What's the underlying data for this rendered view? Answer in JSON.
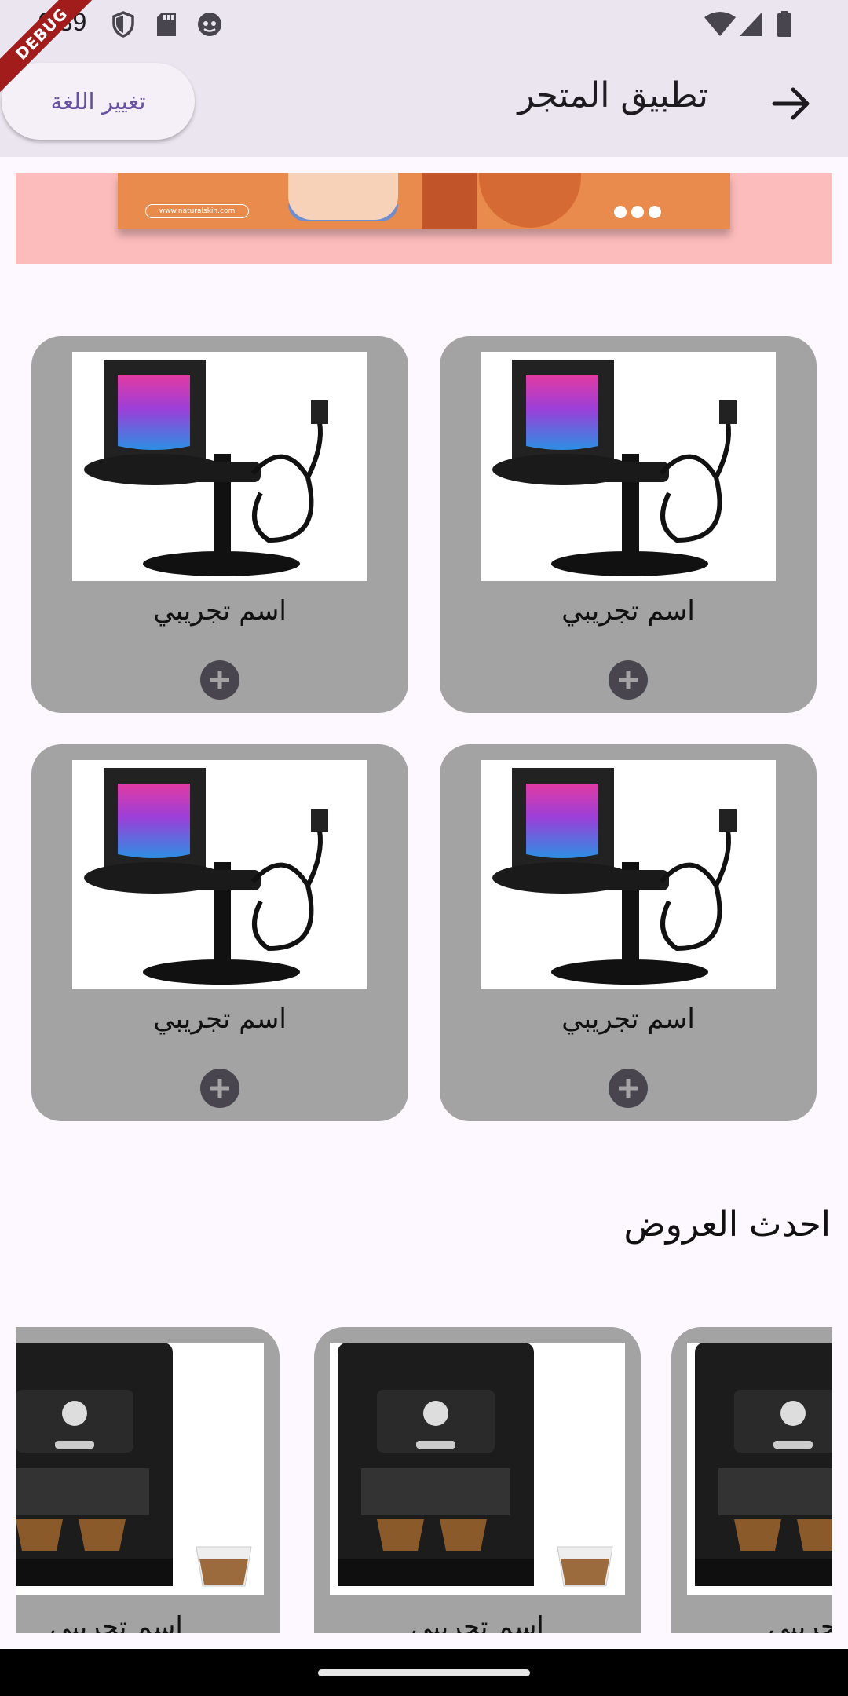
{
  "status_bar": {
    "time": "6:39",
    "left_icons": [
      "shield-icon",
      "sd-card-icon",
      "face-icon"
    ],
    "right_icons": [
      "wifi-icon",
      "signal-icon",
      "battery-icon"
    ]
  },
  "debug_banner": "DEBUG",
  "app_bar": {
    "title": "تطبيق المتجر",
    "language_button": "تغيير اللغة",
    "forward_icon": "arrow-right-icon"
  },
  "banner": {
    "url_text": "www.naturalskin.com"
  },
  "products": [
    {
      "name": "اسم تجريبي",
      "image": "usb-microphone"
    },
    {
      "name": "اسم تجريبي",
      "image": "usb-microphone"
    },
    {
      "name": "اسم تجريبي",
      "image": "usb-microphone"
    },
    {
      "name": "اسم تجريبي",
      "image": "usb-microphone"
    }
  ],
  "offers_section": {
    "title": "احدث العروض",
    "items": [
      {
        "name": "اسم تجريبي",
        "image": "espresso-machine"
      },
      {
        "name": "اسم تجريبي",
        "image": "espresso-machine"
      },
      {
        "name": "اسم تجريبي",
        "image": "espresso-machine"
      }
    ]
  },
  "colors": {
    "app_bar_bg": "#ebe5f0",
    "page_bg": "#fdf7ff",
    "card_bg": "#a3a3a3",
    "banner_bg": "#fdbcbc",
    "accent": "#6750a4",
    "debug_ribbon": "#a31c1c"
  }
}
